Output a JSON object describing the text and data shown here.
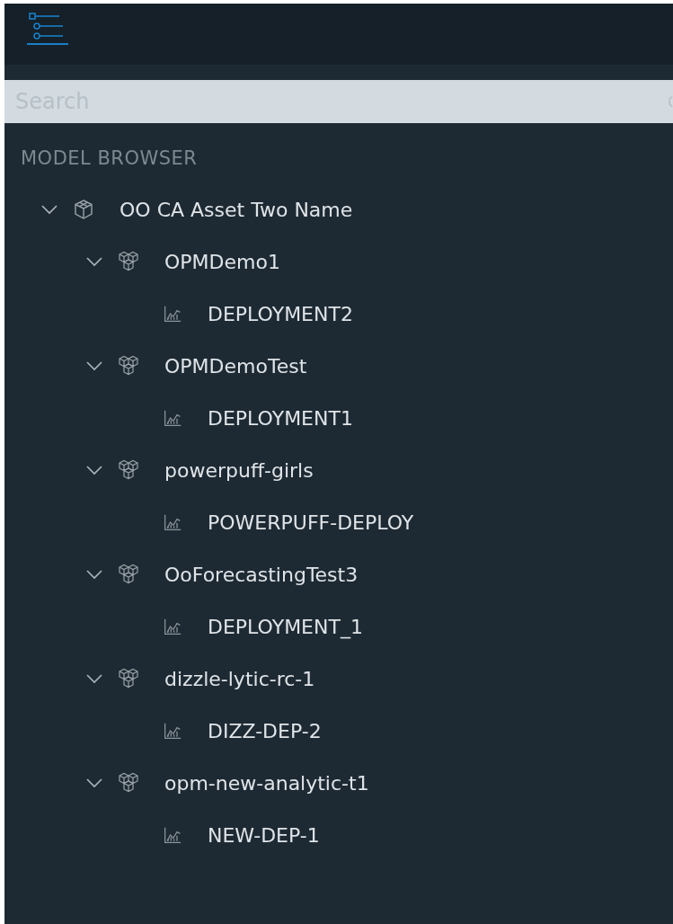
{
  "search": {
    "placeholder": "Search"
  },
  "section_title": "MODEL BROWSER",
  "tree": [
    {
      "label": "OO CA Asset Two Name",
      "kind": "asset",
      "expanded": true,
      "children": [
        {
          "label": "OPMDemo1",
          "kind": "model",
          "expanded": true,
          "children": [
            {
              "label": "DEPLOYMENT2",
              "kind": "deployment"
            }
          ]
        },
        {
          "label": "OPMDemoTest",
          "kind": "model",
          "expanded": true,
          "children": [
            {
              "label": "DEPLOYMENT1",
              "kind": "deployment"
            }
          ]
        },
        {
          "label": "powerpuff-girls",
          "kind": "model",
          "expanded": true,
          "children": [
            {
              "label": "POWERPUFF-DEPLOY",
              "kind": "deployment"
            }
          ]
        },
        {
          "label": "OoForecastingTest3",
          "kind": "model",
          "expanded": true,
          "children": [
            {
              "label": "DEPLOYMENT_1",
              "kind": "deployment"
            }
          ]
        },
        {
          "label": "dizzle-lytic-rc-1",
          "kind": "model",
          "expanded": true,
          "children": [
            {
              "label": "DIZZ-DEP-2",
              "kind": "deployment"
            }
          ]
        },
        {
          "label": "opm-new-analytic-t1",
          "kind": "model",
          "expanded": true,
          "children": [
            {
              "label": "NEW-DEP-1",
              "kind": "deployment"
            }
          ]
        }
      ]
    }
  ]
}
